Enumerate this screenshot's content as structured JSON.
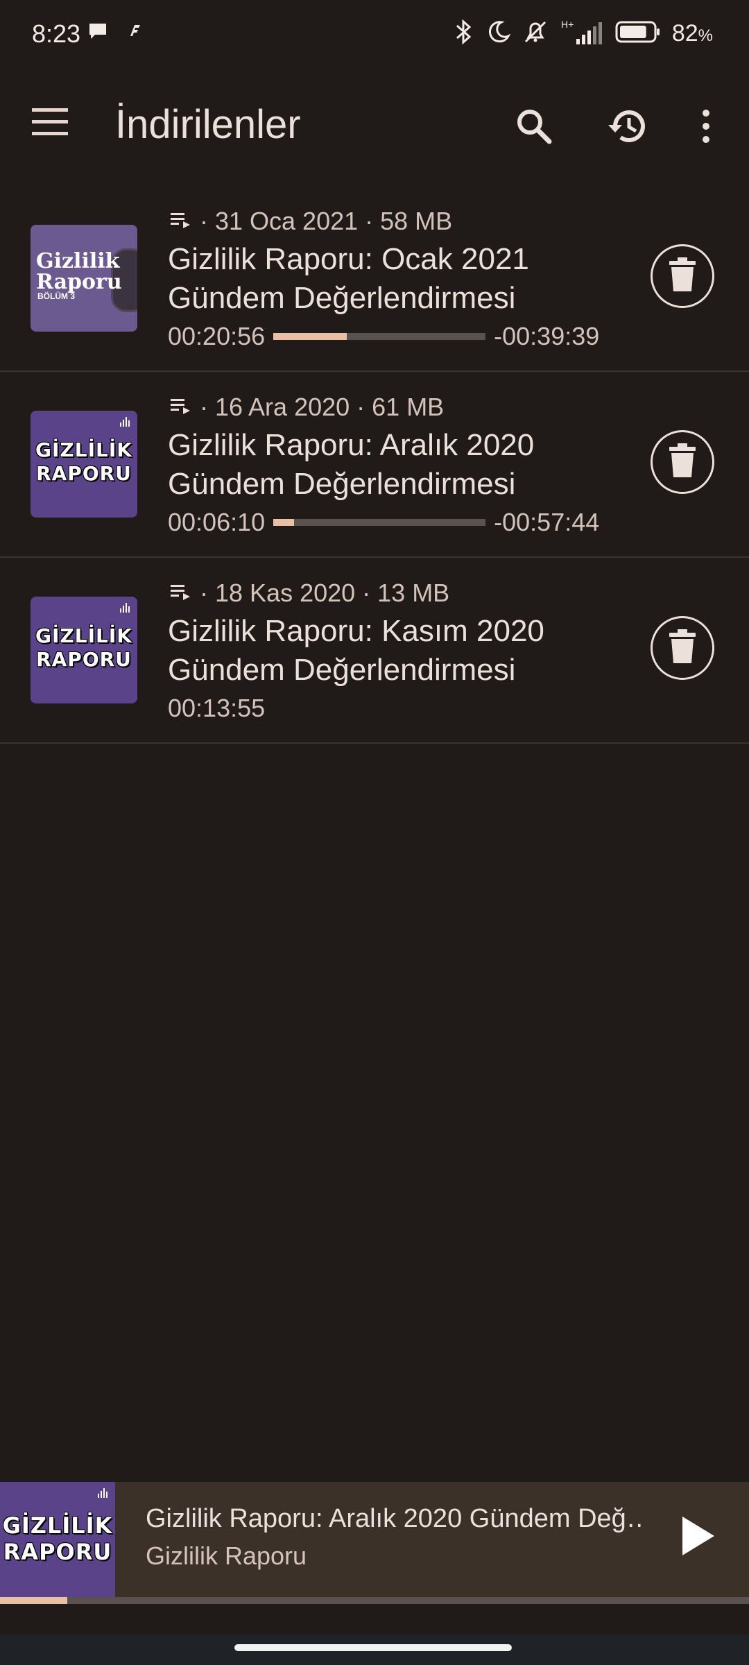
{
  "status_bar": {
    "time": "8:23",
    "network": "H+",
    "battery_percent": "82",
    "battery_unit": "%",
    "battery_level": 0.82
  },
  "app_bar": {
    "title": "İndirilenler",
    "icons": [
      "menu-icon",
      "search-icon",
      "history-icon",
      "more-vert-icon"
    ]
  },
  "episodes": [
    {
      "meta": "· 31 Oca 2021 · 58 MB",
      "title": "Gizlilik Raporu: Ocak 2021 Gündem Değerlendirmesi",
      "elapsed": "00:20:56",
      "remaining": "-00:39:39",
      "progress": 0.345,
      "thumb_text": "Gizlilik Raporu",
      "thumb_sub": "BÖLÜM 3"
    },
    {
      "meta": "· 16 Ara 2020 · 61 MB",
      "title": "Gizlilik Raporu: Aralık 2020 Gündem Değerlendirmesi",
      "elapsed": "00:06:10",
      "remaining": "-00:57:44",
      "progress": 0.097,
      "thumb_text": "GİZLİLİK RAPORU"
    },
    {
      "meta": "· 18 Kas 2020 · 13 MB",
      "title": "Gizlilik Raporu: Kasım 2020 Gündem Değerlendirmesi",
      "duration": "00:13:55",
      "thumb_text": "GİZLİLİK RAPORU"
    }
  ],
  "mini_player": {
    "title": "Gizlilik Raporu: Aralık 2020 Gündem Değ…",
    "podcast": "Gizlilik Raporu",
    "thumb_text": "GİZLİLİK RAPORU",
    "progress": 0.09
  },
  "colors": {
    "background": "#201b18",
    "accent": "#e9bfa6",
    "thumb_purple": "#5a4389"
  }
}
